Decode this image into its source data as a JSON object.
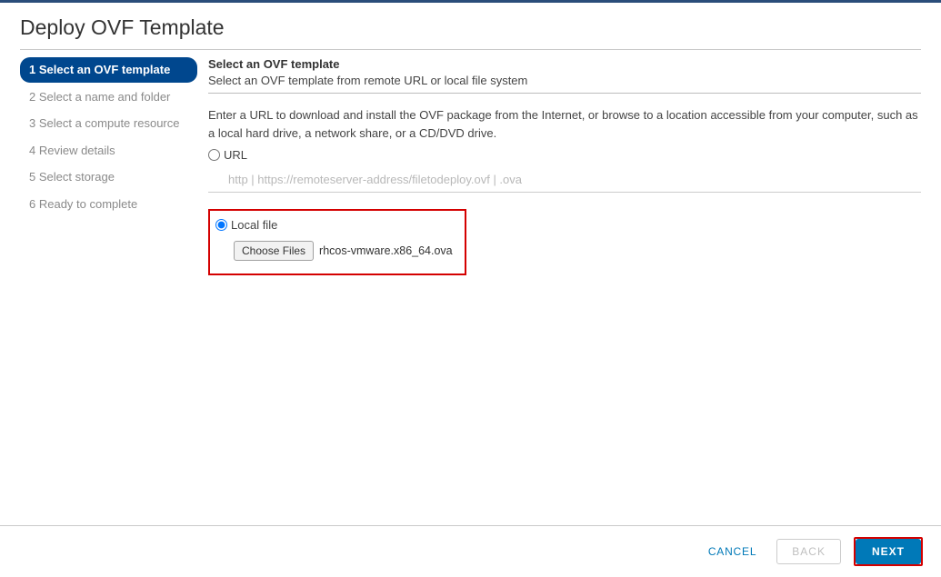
{
  "header": {
    "title": "Deploy OVF Template"
  },
  "steps": [
    {
      "label": "1 Select an OVF template",
      "active": true
    },
    {
      "label": "2 Select a name and folder",
      "active": false
    },
    {
      "label": "3 Select a compute resource",
      "active": false
    },
    {
      "label": "4 Review details",
      "active": false
    },
    {
      "label": "5 Select storage",
      "active": false
    },
    {
      "label": "6 Ready to complete",
      "active": false
    }
  ],
  "content": {
    "title": "Select an OVF template",
    "subtitle": "Select an OVF template from remote URL or local file system",
    "description": "Enter a URL to download and install the OVF package from the Internet, or browse to a location accessible from your computer, such as a local hard drive, a network share, or a CD/DVD drive.",
    "url_label": "URL",
    "url_placeholder": "http | https://remoteserver-address/filetodeploy.ovf | .ova",
    "local_label": "Local file",
    "choose_label": "Choose Files",
    "file_name": "rhcos-vmware.x86_64.ova",
    "source_selected": "local"
  },
  "footer": {
    "cancel": "CANCEL",
    "back": "BACK",
    "next": "NEXT"
  }
}
